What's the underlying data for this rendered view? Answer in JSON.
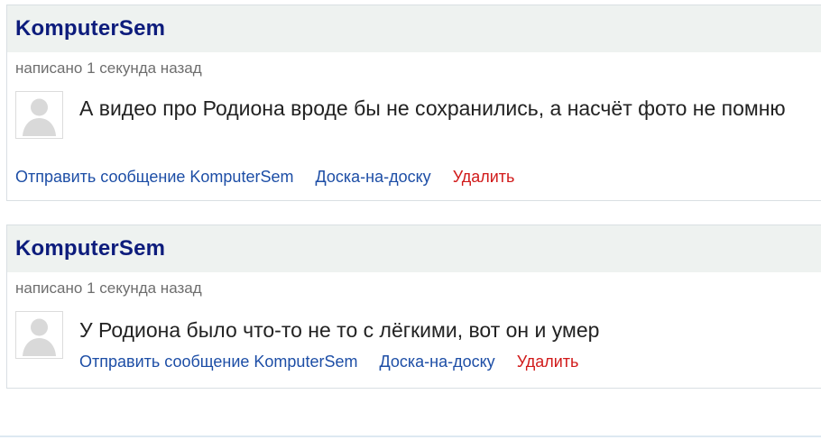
{
  "comments": [
    {
      "author": "KomputerSem",
      "timestamp": "написано 1 секунда назад",
      "text": "А видео про Родиона вроде бы не сохранились, а насчёт фото не помню",
      "actions": {
        "message": "Отправить сообщение KomputerSem",
        "board": "Доска-на-доску",
        "delete": "Удалить"
      },
      "avatar_icon": "default-user-silhouette"
    },
    {
      "author": "KomputerSem",
      "timestamp": "написано 1 секунда назад",
      "text": "У Родиона было что-то не то с лёгкими, вот он и умер",
      "actions": {
        "message": "Отправить сообщение KomputerSem",
        "board": "Доска-на-доску",
        "delete": "Удалить"
      },
      "avatar_icon": "default-user-silhouette"
    }
  ],
  "colors": {
    "author": "#0d1c7c",
    "link": "#1d4ea6",
    "delete": "#d11a1a",
    "header_bg": "#eef2f0",
    "meta": "#6e6e6e"
  }
}
